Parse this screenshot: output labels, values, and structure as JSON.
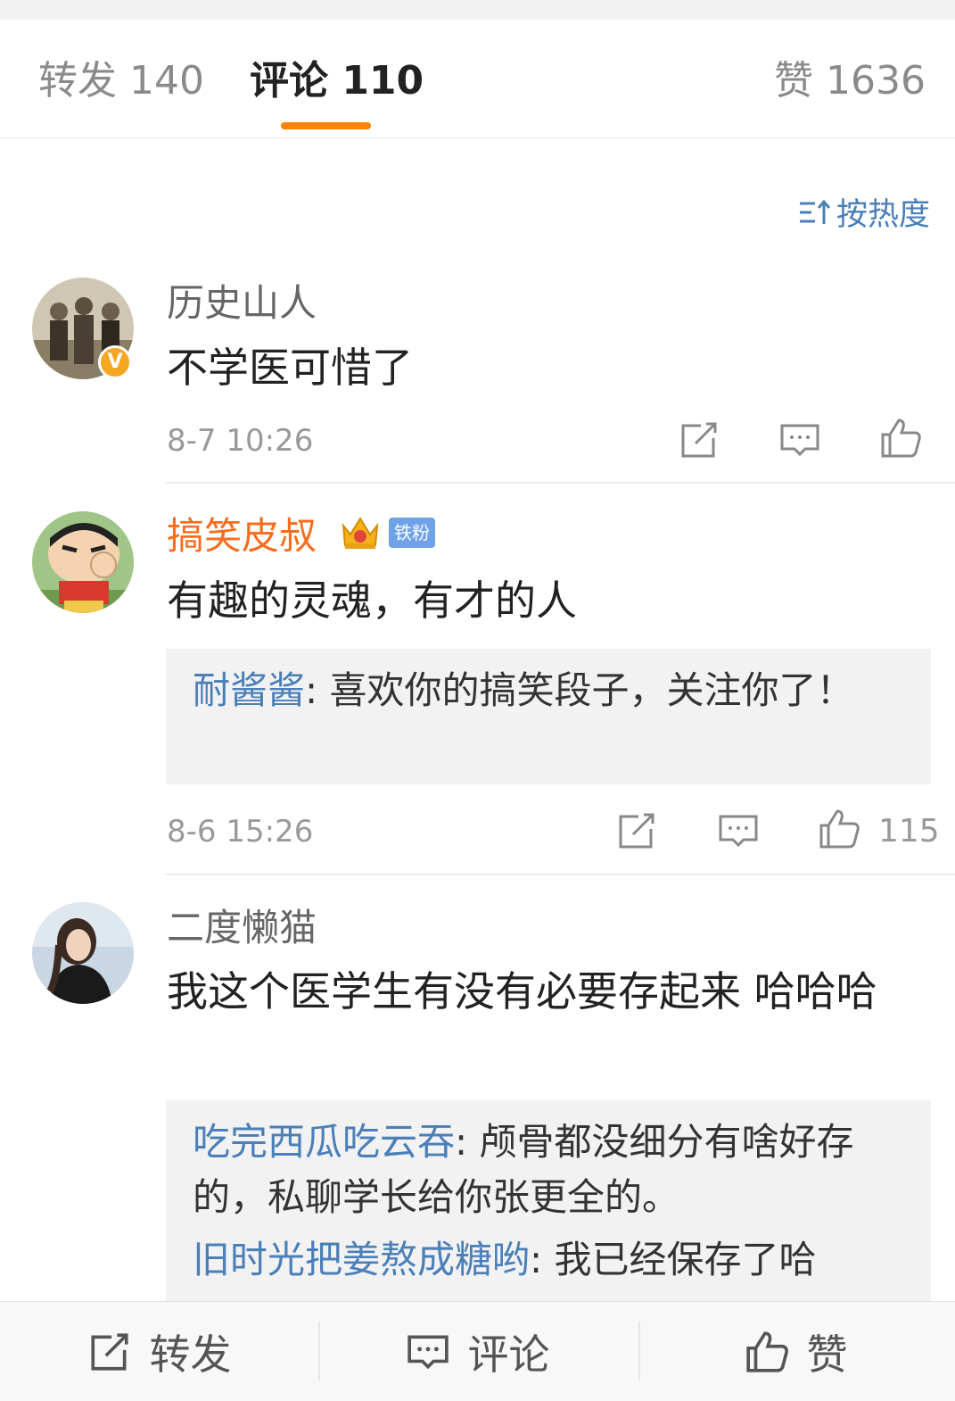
{
  "tabs": [
    {
      "label": "转发 140"
    },
    {
      "label": "评论 110"
    },
    {
      "label": "赞 1636"
    }
  ],
  "sort_label": "按热度",
  "comments": [
    {
      "username": "历史山人",
      "text": "不学医可惜了",
      "time": "8-7 10:26",
      "verified_badge": "V"
    },
    {
      "username": "搞笑皮叔",
      "fan_badge": "铁粉",
      "text": "有趣的灵魂，有才的人",
      "replies": [
        {
          "name": "耐酱酱",
          "text": ": 喜欢你的搞笑段子，关注你了！"
        }
      ],
      "time": "8-6 15:26",
      "likes": "115"
    },
    {
      "username": "二度懒猫",
      "text": "我这个医学生有没有必要存起来 哈哈哈",
      "replies": [
        {
          "name": "吃完西瓜吃云吞",
          "text": ": 颅骨都没细分有啥好存的，私聊学长给你张更全的。"
        },
        {
          "name": "旧时光把姜熬成糖哟",
          "text": ": 我已经保存了哈"
        }
      ]
    }
  ],
  "bottom_bar": {
    "repost": "转发",
    "comment": "评论",
    "like": "赞"
  },
  "colors": {
    "accent": "#ff8200",
    "link": "#4a7fb8",
    "vip_name": "#f76d1e"
  }
}
